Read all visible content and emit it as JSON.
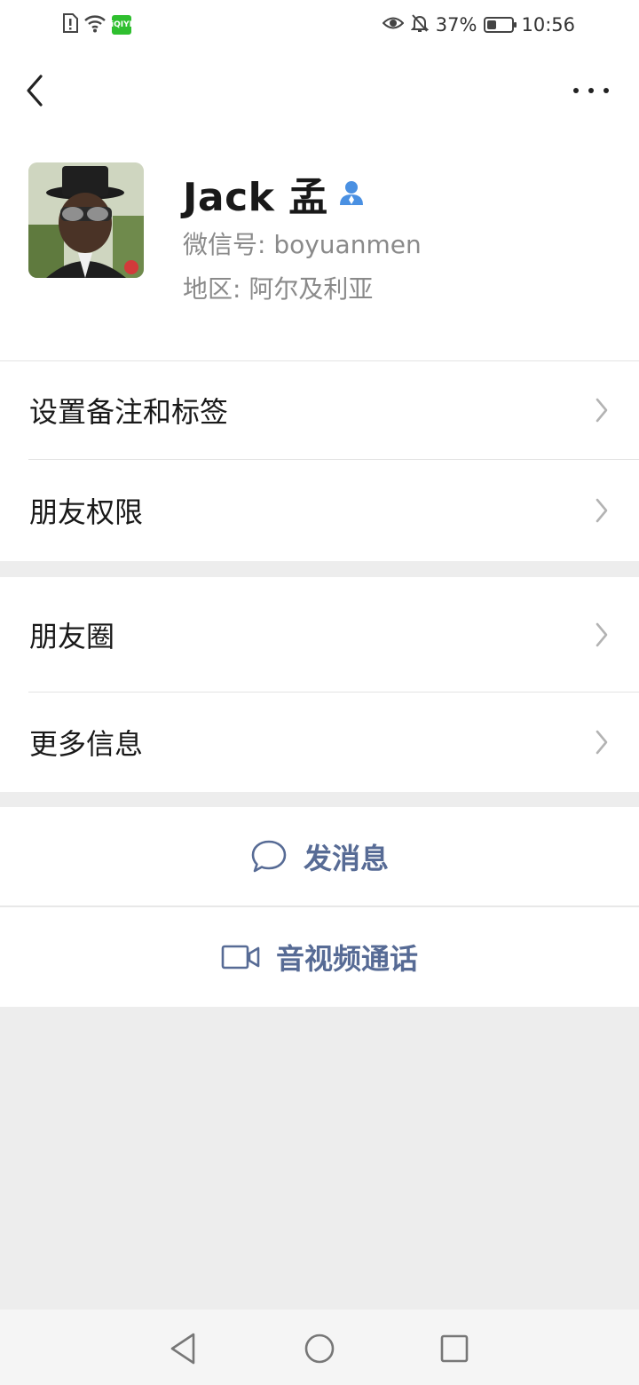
{
  "status_bar": {
    "battery_percent": "37%",
    "time": "10:56",
    "battery_level": 0.37
  },
  "header": {
    "back_icon": "chevron-left-icon",
    "more_icon": "more-icon"
  },
  "profile": {
    "name": "Jack 孟",
    "wechat_id": "微信号: boyuanmen",
    "region": "地区: 阿尔及利亚",
    "contact_icon_color": "#4a90e2"
  },
  "section1": {
    "items": [
      {
        "label": "设置备注和标签"
      },
      {
        "label": "朋友权限"
      }
    ]
  },
  "section2": {
    "items": [
      {
        "label": "朋友圈"
      },
      {
        "label": "更多信息"
      }
    ]
  },
  "actions": {
    "message_label": "发消息",
    "call_label": "音视频通话",
    "accent_color": "#576b95"
  }
}
